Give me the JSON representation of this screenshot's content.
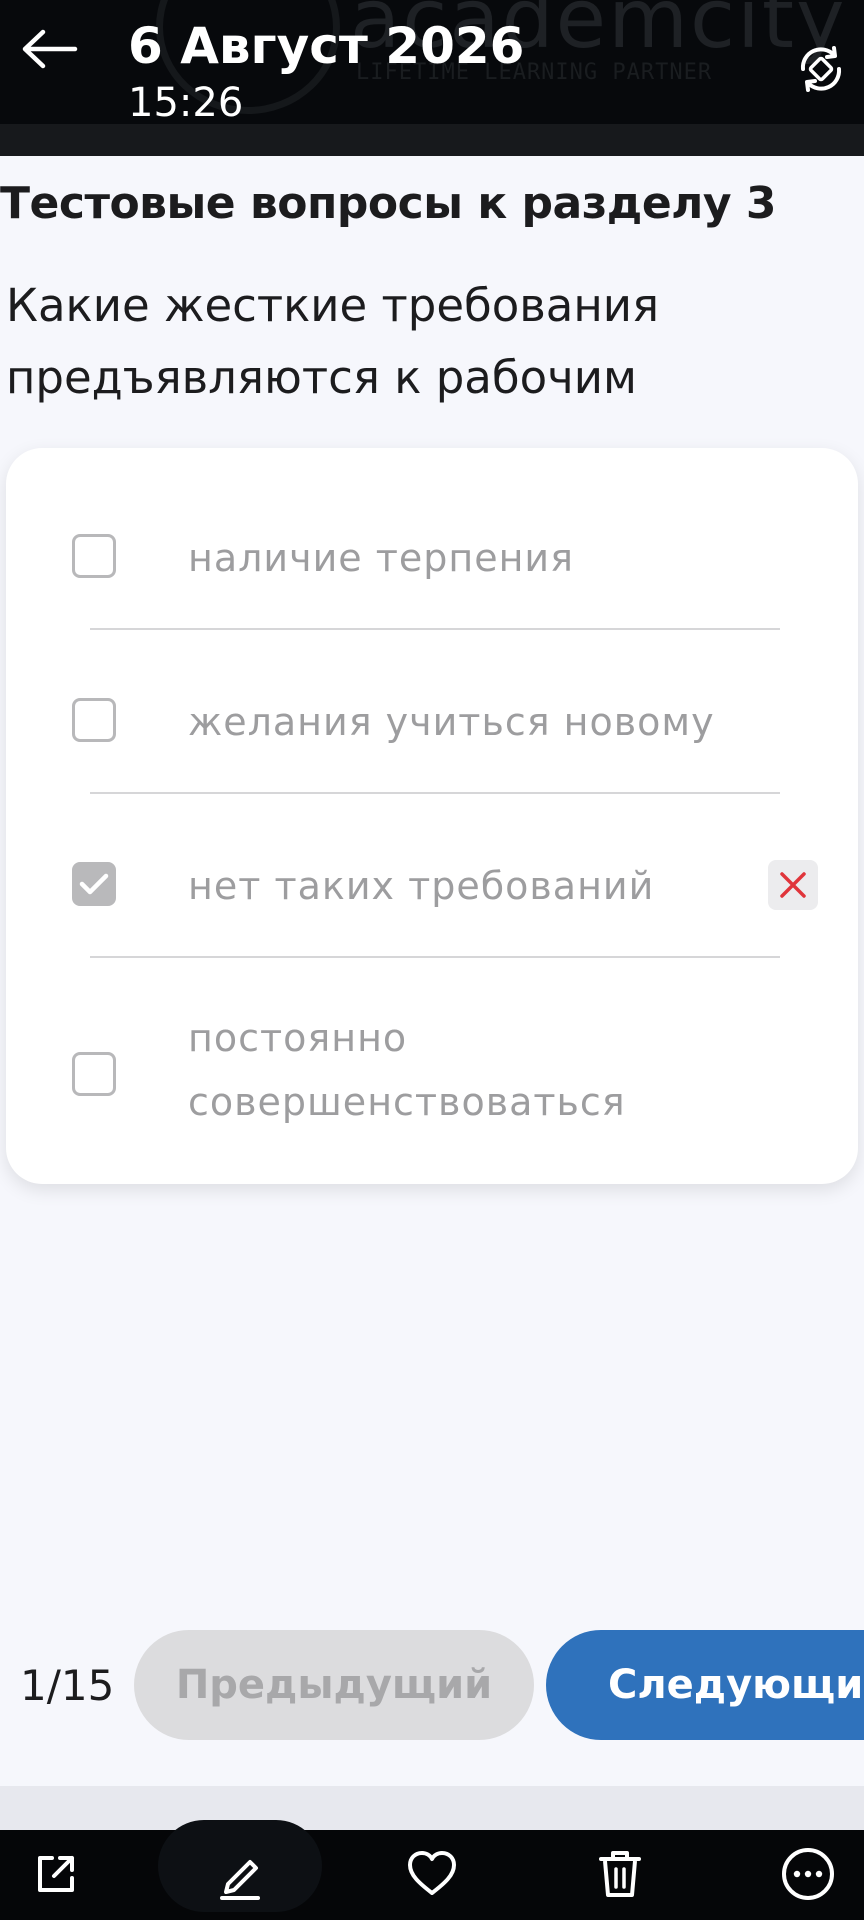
{
  "header": {
    "date": "6 Август 2026",
    "time": "15:26",
    "watermark_brand": "academcity",
    "watermark_tagline": "LIFETIME LEARNING PARTNER"
  },
  "section_title": "Тестовые вопросы к разделу 3",
  "question": {
    "line1": "Какие жесткие требования",
    "line2": "предъявляются к рабочим"
  },
  "answers": [
    {
      "label": "наличие терпения",
      "checked": false
    },
    {
      "label": "желания учиться новому",
      "checked": false
    },
    {
      "label": "нет таких требований",
      "checked": true,
      "marked_wrong": true
    },
    {
      "label_line1": "постоянно",
      "label_line2": "совершенствоваться",
      "checked": false
    }
  ],
  "navigation": {
    "counter": "1/15",
    "prev_label": "Предыдущий",
    "next_label": "Следующий"
  },
  "colors": {
    "header_bg": "#07090c",
    "page_bg": "#f6f7fc",
    "next_button": "#2f72bc",
    "prev_button": "#dcdcde",
    "wrong_mark": "#e0353b"
  },
  "toolbar_icons": [
    "share-icon",
    "edit-icon",
    "heart-icon",
    "trash-icon",
    "more-icon"
  ]
}
